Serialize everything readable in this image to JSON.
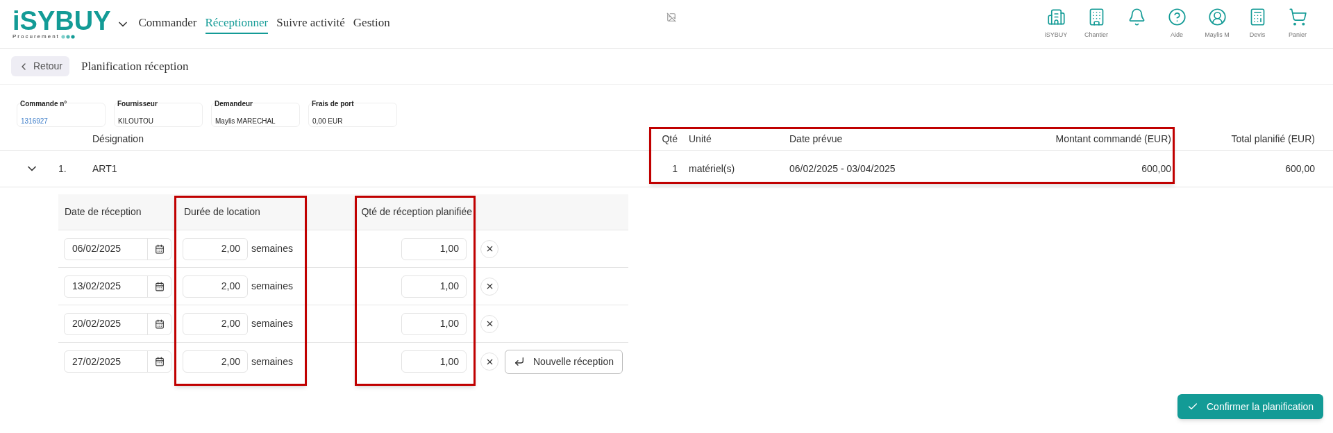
{
  "header": {
    "logo": {
      "name": "iSYBUY",
      "tagline": "Procurement"
    },
    "nav": [
      {
        "label": "Commander",
        "selected": false
      },
      {
        "label": "Réceptionner",
        "selected": true
      },
      {
        "label": "Suivre activité",
        "selected": false
      },
      {
        "label": "Gestion",
        "selected": false
      }
    ],
    "actions": [
      {
        "kind": "buildings",
        "label": "iSYBUY"
      },
      {
        "kind": "building",
        "label": "Chantier"
      },
      {
        "kind": "bell"
      },
      {
        "kind": "help",
        "label": "Aide"
      },
      {
        "kind": "user",
        "label": "Maylis M"
      },
      {
        "kind": "calculator",
        "label": "Devis"
      },
      {
        "kind": "cart",
        "label": "Panier"
      }
    ]
  },
  "toolbar": {
    "back_button": "Retour",
    "title": "Planification réception"
  },
  "info_cards": [
    {
      "label": "Commande n°",
      "value": "1316927",
      "kind": "link"
    },
    {
      "label": "Fournisseur",
      "value": "KILOUTOU",
      "kind": "text"
    },
    {
      "label": "Demandeur",
      "value": "Maylis MARECHAL",
      "kind": "text"
    },
    {
      "label": "Frais de port",
      "value": "0,00 EUR",
      "kind": "text"
    }
  ],
  "table": {
    "columns": {
      "designation": "Désignation",
      "qty": "Qté",
      "unit": "Unité",
      "date": "Date prévue",
      "amount": "Montant commandé (EUR)",
      "total": "Total planifié (EUR)"
    },
    "rows": [
      {
        "expanded": true,
        "number": "1.",
        "designation": "ART1",
        "qty": "1",
        "unit": "matériel(s)",
        "date": "06/02/2025 - 03/04/2025",
        "amount": "600,00",
        "total": "600,00",
        "receptions": {
          "columns": [
            "Date de réception",
            "Durée de location",
            "Qté de réception planifiée"
          ],
          "rows": [
            {
              "date": "06/02/2025",
              "duration": "2,00",
              "duration_unit": "semaines",
              "qty": "1,00"
            },
            {
              "date": "13/02/2025",
              "duration": "2,00",
              "duration_unit": "semaines",
              "qty": "1,00"
            },
            {
              "date": "20/02/2025",
              "duration": "2,00",
              "duration_unit": "semaines",
              "qty": "1,00"
            },
            {
              "date": "27/02/2025",
              "duration": "2,00",
              "duration_unit": "semaines",
              "qty": "1,00"
            }
          ],
          "add_button": "Nouvelle réception"
        }
      }
    ]
  },
  "confirm_button": "Confirmer la planification"
}
